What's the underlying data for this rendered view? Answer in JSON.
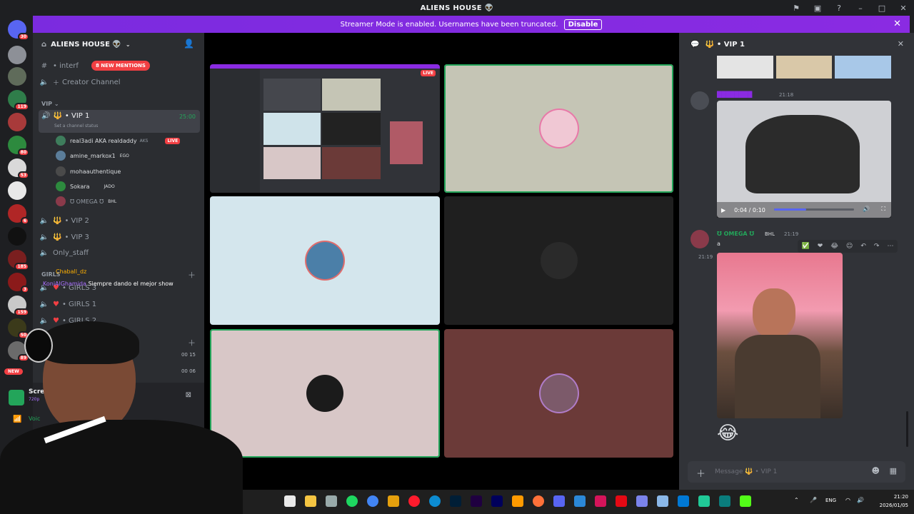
{
  "app": {
    "title": "ALIENS HOUSE 👽"
  },
  "banner": {
    "text": "Streamer Mode is enabled. Usernames have been truncated.",
    "disable_label": "Disable"
  },
  "server_badges": [
    "30",
    "119",
    "80",
    "53",
    "6",
    "185",
    "3",
    "159",
    "50",
    "89"
  ],
  "new_badge": "NEW",
  "guild": {
    "name": "ALIENS HOUSE 👽"
  },
  "channels": {
    "interf": "• interf",
    "mentions": "8 NEW MENTIONS",
    "creator": "Creator Channel",
    "vip_category": "VIP",
    "vip1": "• VIP 1",
    "vip1_timer": "25:00",
    "vip1_status": "Set a channel status",
    "vip2": "• VIP 2",
    "vip3": "• VIP 3",
    "only_staff": "Only_staff",
    "girls_category": "GIRLS",
    "girls3": "• GIRLS 3",
    "girls1": "• GIRLS 1",
    "girls2": "• GIRLS 2",
    "counter1": "00 15",
    "counter2": "00 06"
  },
  "voice_users": [
    {
      "name": "real3adi AKA realdaddy",
      "tag": "AKS",
      "live": "LIVE"
    },
    {
      "name": "amine_markox1",
      "tag": "EGO"
    },
    {
      "name": "mohaauthentique",
      "tag": ""
    },
    {
      "name": "Sokara",
      "tag": "JADO"
    },
    {
      "name": "Ʊ OMEGA Ʊ",
      "tag": "BHL"
    }
  ],
  "stream_chat": [
    {
      "user": "Chaball_dz",
      "text": ""
    },
    {
      "user": "KoniAlGhamida",
      "text": "Siempre dando el mejor show"
    }
  ],
  "panel": {
    "screen": "Screen",
    "screen_sub": "720p",
    "voice": "Voic"
  },
  "stage": {
    "live_label": "LIVE"
  },
  "chat": {
    "channel": "• VIP 1",
    "msg1_time": "21:18",
    "video_time": "0:04 / 0:10",
    "video_progress": 0.4,
    "msg2_name": "Ʊ OMEGA Ʊ",
    "msg2_tag": "BHL",
    "msg2_time": "21:19",
    "msg2_text": "a",
    "msg2_side_time": "21:19",
    "reaction_emoji": "😂",
    "placeholder": "Message 🔱 • VIP 1"
  },
  "taskbar": {
    "search": "ch",
    "lang": "ENG",
    "time": "21:20",
    "date": "2026/01/05"
  }
}
